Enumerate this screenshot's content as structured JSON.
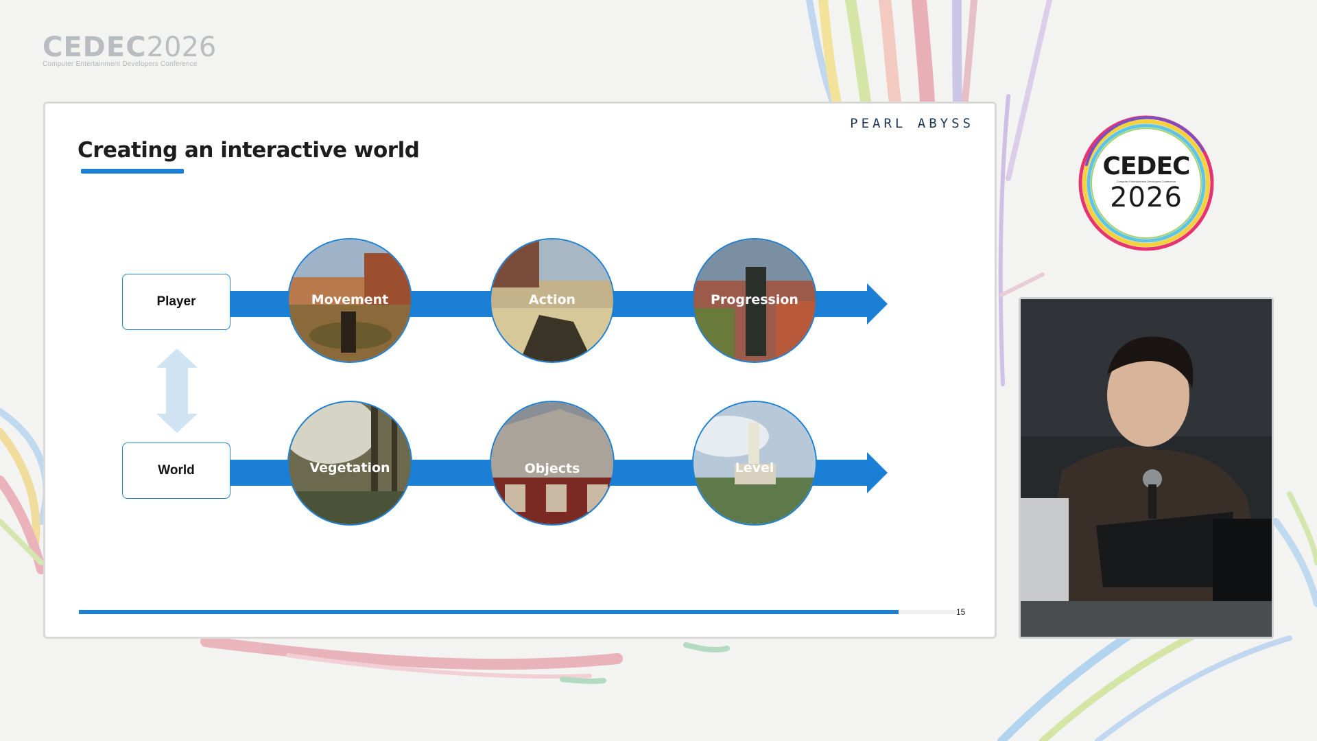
{
  "event_logo": {
    "brand": "CEDEC",
    "year": "2026",
    "subtitle": "Computer Entertainment Developers Conference"
  },
  "slide": {
    "brand": "PEARL ABYSS",
    "title": "Creating an interactive world",
    "page_number": "15",
    "progress": 0.935,
    "rows": [
      {
        "label": "Player",
        "stages": [
          "Movement",
          "Action",
          "Progression"
        ]
      },
      {
        "label": "World",
        "stages": [
          "Vegetation",
          "Objects",
          "Level"
        ]
      }
    ]
  },
  "side_logo": {
    "brand": "CEDEC",
    "subtitle": "Computer Entertainment Developers Conference",
    "year": "2026"
  },
  "colors": {
    "accent": "#1b7fd6",
    "arrow_light": "#cfe3f3",
    "background": "#f3f3f1"
  }
}
